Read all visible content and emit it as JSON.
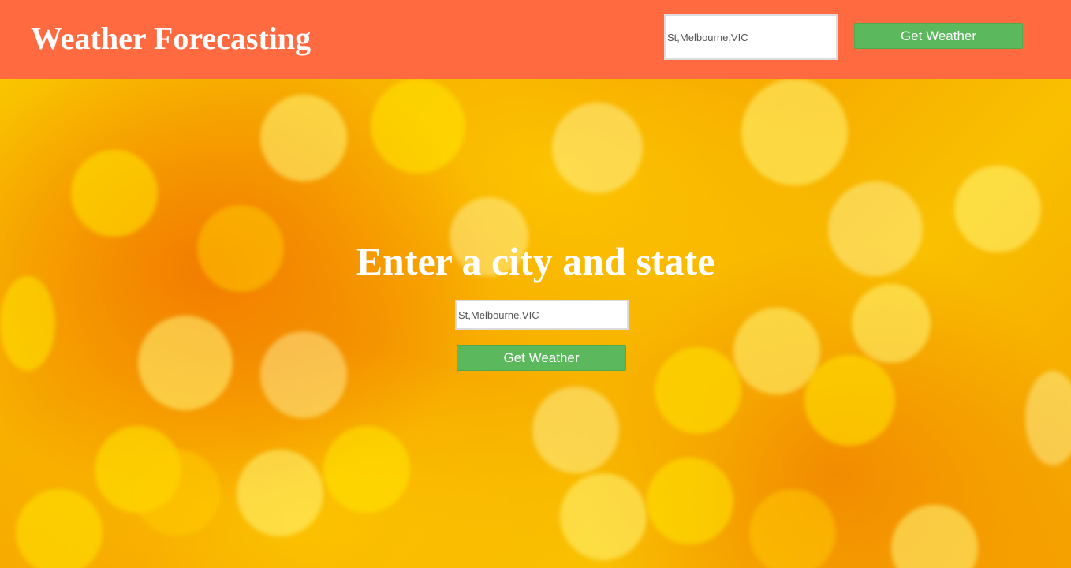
{
  "header": {
    "title": "Weather Forecasting",
    "search_value": "St,Melbourne,VIC",
    "button_label": "Get Weather"
  },
  "hero": {
    "heading": "Enter a city and state",
    "search_value": "St,Melbourne,VIC",
    "button_label": "Get Weather"
  },
  "colors": {
    "header_background": "#ff6a40",
    "button_background": "#5cb85c",
    "title_text": "#ffffff"
  }
}
